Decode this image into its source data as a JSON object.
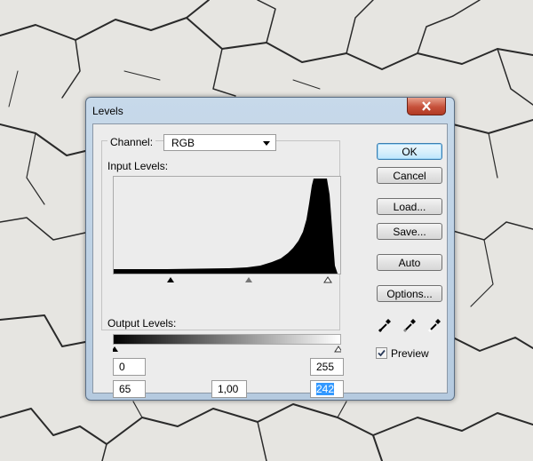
{
  "window": {
    "title": "Levels"
  },
  "channel": {
    "label": "Channel:",
    "value": "RGB"
  },
  "input_levels": {
    "label": "Input Levels:",
    "black": "65",
    "gamma": "1,00",
    "white": "242"
  },
  "output_levels": {
    "label": "Output Levels:",
    "black": "0",
    "white": "255"
  },
  "buttons": {
    "ok": "OK",
    "cancel": "Cancel",
    "load": "Load...",
    "save": "Save...",
    "auto": "Auto",
    "options": "Options..."
  },
  "preview": {
    "label": "Preview",
    "checked": true
  },
  "icons": {
    "close": "close-icon",
    "black_eyedropper": "black-eyedropper-icon",
    "gray_eyedropper": "gray-eyedropper-icon",
    "white_eyedropper": "white-eyedropper-icon"
  }
}
